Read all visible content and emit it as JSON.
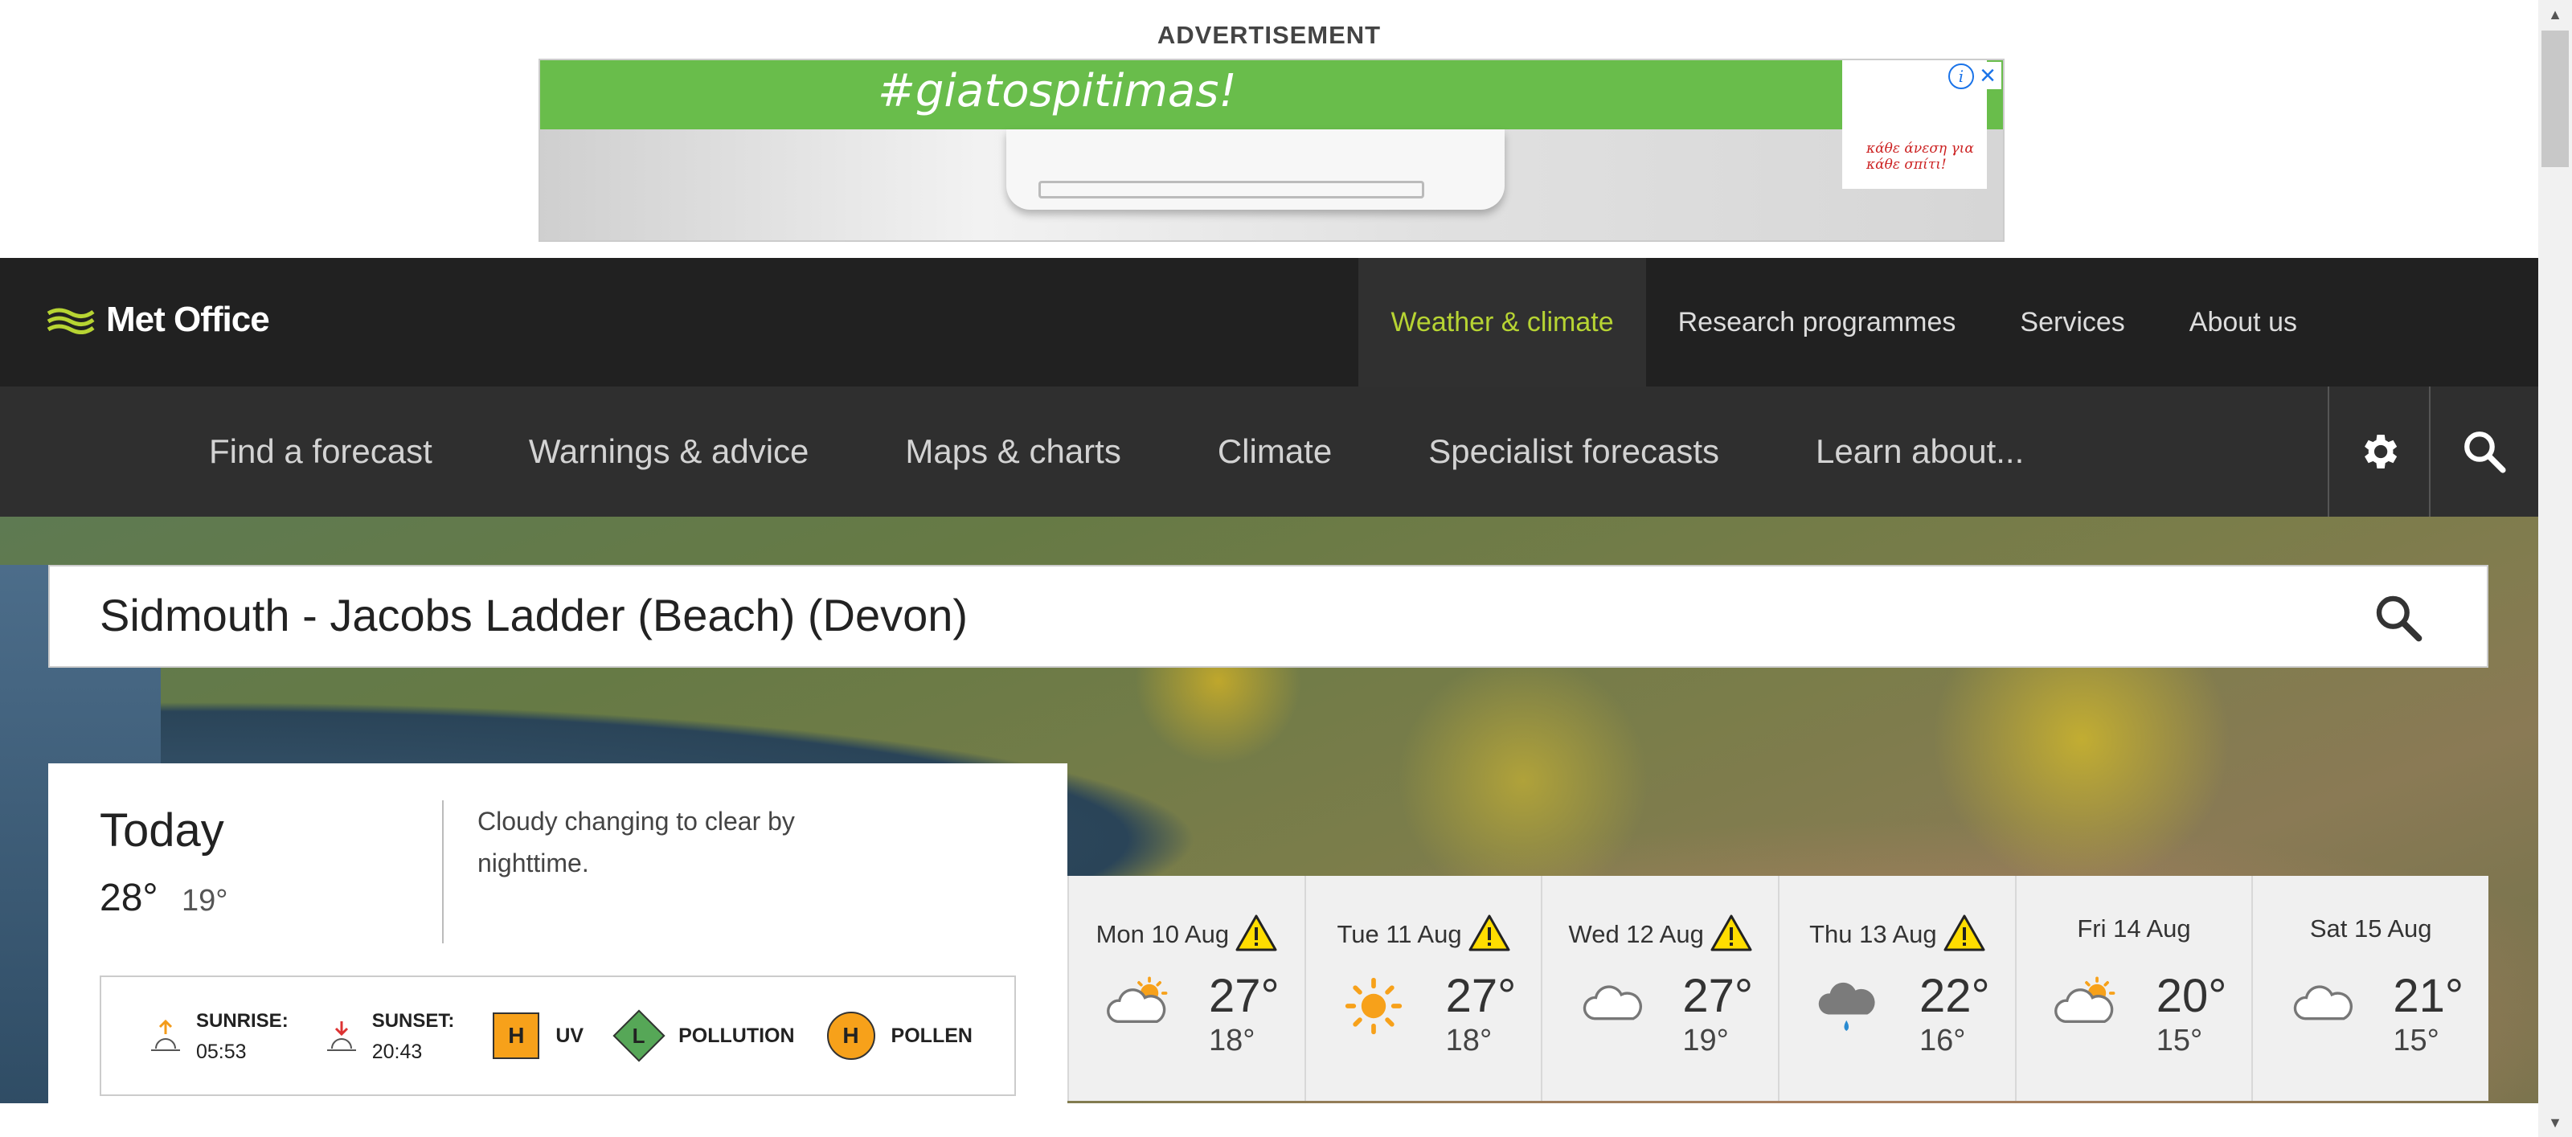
{
  "advertisement": {
    "label": "ADVERTISEMENT",
    "tagline": "#giatospitimas!",
    "brand_text": "κάθε άνεση για κάθε σπίτι!"
  },
  "header": {
    "logo_text": "Met Office",
    "nav": [
      {
        "label": "Weather & climate",
        "active": true
      },
      {
        "label": "Research programmes"
      },
      {
        "label": "Services"
      },
      {
        "label": "About us"
      }
    ]
  },
  "subnav": [
    {
      "label": "Find a forecast"
    },
    {
      "label": "Warnings & advice"
    },
    {
      "label": "Maps & charts"
    },
    {
      "label": "Climate"
    },
    {
      "label": "Specialist forecasts"
    },
    {
      "label": "Learn about..."
    }
  ],
  "search": {
    "value": "Sidmouth - Jacobs Ladder (Beach) (Devon)"
  },
  "today": {
    "title": "Today",
    "high": "28°",
    "low": "19°",
    "description": "Cloudy changing to clear by nighttime.",
    "sunrise_label": "SUNRISE:",
    "sunrise_time": "05:53",
    "sunset_label": "SUNSET:",
    "sunset_time": "20:43",
    "uv_level": "H",
    "uv_label": "UV",
    "pollution_level": "L",
    "pollution_label": "POLLUTION",
    "pollen_level": "H",
    "pollen_label": "POLLEN"
  },
  "forecast": [
    {
      "day": "Mon 10 Aug",
      "warning": true,
      "icon": "sunny-intervals-icon",
      "high": "27°",
      "low": "18°"
    },
    {
      "day": "Tue 11 Aug",
      "warning": true,
      "icon": "sunny-icon",
      "high": "27°",
      "low": "18°"
    },
    {
      "day": "Wed 12 Aug",
      "warning": true,
      "icon": "cloudy-icon",
      "high": "27°",
      "low": "19°"
    },
    {
      "day": "Thu 13 Aug",
      "warning": true,
      "icon": "light-rain-icon",
      "high": "22°",
      "low": "16°"
    },
    {
      "day": "Fri 14 Aug",
      "warning": false,
      "icon": "sunny-intervals-icon",
      "high": "20°",
      "low": "15°"
    },
    {
      "day": "Sat 15 Aug",
      "warning": false,
      "icon": "cloudy-icon",
      "high": "21°",
      "low": "15°"
    }
  ],
  "colors": {
    "accent": "#b7d433",
    "nav_bg": "#212121",
    "subnav_bg": "#2f2f2f",
    "warning_yellow": "#ffdd00",
    "uv_orange": "#f7a11a",
    "pollution_green": "#56a757"
  }
}
